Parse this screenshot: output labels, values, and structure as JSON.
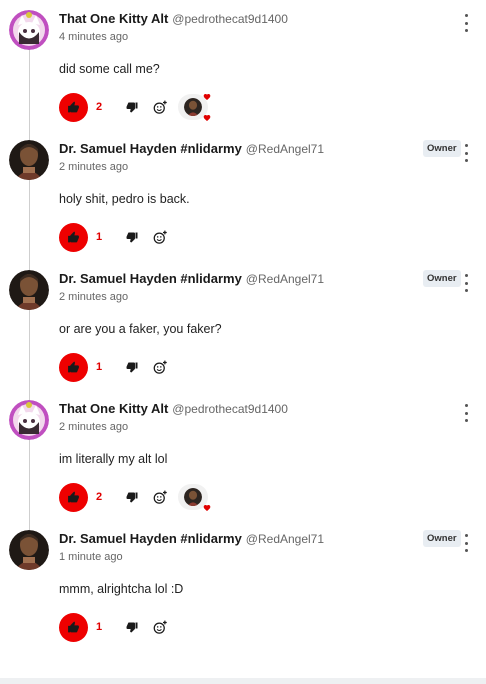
{
  "comments": [
    {
      "author": "That One Kitty Alt",
      "handle": "@pedrothecat9d1400",
      "time": "4 minutes ago",
      "text": "did some call me?",
      "likes": "2",
      "owner": "",
      "reaction": true
    },
    {
      "author": "Dr. Samuel Hayden #nlidarmy",
      "handle": "@RedAngel71",
      "time": "2 minutes ago",
      "text": "holy shit, pedro is back.",
      "likes": "1",
      "owner": "Owner",
      "reaction": false
    },
    {
      "author": "Dr. Samuel Hayden #nlidarmy",
      "handle": "@RedAngel71",
      "time": "2 minutes ago",
      "text": "or are you a faker, you faker?",
      "likes": "1",
      "owner": "Owner",
      "reaction": false
    },
    {
      "author": "That One Kitty Alt",
      "handle": "@pedrothecat9d1400",
      "time": "2 minutes ago",
      "text": "im literally my alt lol",
      "likes": "2",
      "owner": "",
      "reaction": true
    },
    {
      "author": "Dr. Samuel Hayden #nlidarmy",
      "handle": "@RedAngel71",
      "time": "1 minute ago",
      "text": "mmm, alrightcha lol :D",
      "likes": "1",
      "owner": "Owner",
      "reaction": false
    }
  ],
  "colors": {
    "like": "#ee0000",
    "likeCount": "#e00000",
    "badge": "#e8edf2"
  },
  "icons": [
    "thumbs-up-icon",
    "thumbs-down-icon",
    "add-reaction-icon",
    "more-vert-icon",
    "heart-icon"
  ]
}
